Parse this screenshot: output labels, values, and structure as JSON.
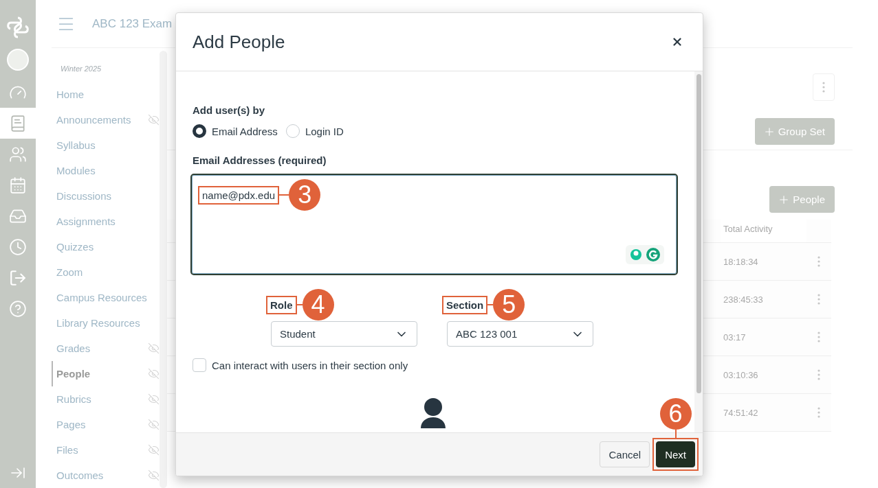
{
  "rail": {
    "items": [
      {
        "selected": false
      },
      {
        "selected": false
      },
      {
        "selected": true
      },
      {
        "selected": false
      },
      {
        "selected": false
      },
      {
        "selected": false
      },
      {
        "selected": false
      },
      {
        "selected": false
      },
      {
        "selected": false
      }
    ]
  },
  "course_nav": {
    "title": "ABC 123 Exam",
    "term": "Winter 2025",
    "items": [
      {
        "label": "Home",
        "hidden": false,
        "selected": false
      },
      {
        "label": "Announcements",
        "hidden": true,
        "selected": false
      },
      {
        "label": "Syllabus",
        "hidden": false,
        "selected": false
      },
      {
        "label": "Modules",
        "hidden": false,
        "selected": false
      },
      {
        "label": "Discussions",
        "hidden": false,
        "selected": false
      },
      {
        "label": "Assignments",
        "hidden": false,
        "selected": false
      },
      {
        "label": "Quizzes",
        "hidden": false,
        "selected": false
      },
      {
        "label": "Zoom",
        "hidden": false,
        "selected": false
      },
      {
        "label": "Campus Resources",
        "hidden": false,
        "selected": false
      },
      {
        "label": "Library Resources",
        "hidden": false,
        "selected": false
      },
      {
        "label": "Grades",
        "hidden": true,
        "selected": false
      },
      {
        "label": "People",
        "hidden": true,
        "selected": true
      },
      {
        "label": "Rubrics",
        "hidden": true,
        "selected": false
      },
      {
        "label": "Pages",
        "hidden": true,
        "selected": false
      },
      {
        "label": "Files",
        "hidden": true,
        "selected": false
      },
      {
        "label": "Outcomes",
        "hidden": true,
        "selected": false
      }
    ]
  },
  "page": {
    "buttons": [
      {
        "label": "Group Set"
      },
      {
        "label": "People"
      }
    ],
    "table": {
      "columns": [
        "Total Activity"
      ],
      "rows": [
        {
          "total_activity": "18:18:34"
        },
        {
          "total_activity": "238:45:33"
        },
        {
          "total_activity": "03:17"
        },
        {
          "total_activity": "03:10:36"
        },
        {
          "total_activity": "74:51:42"
        }
      ]
    }
  },
  "dialog": {
    "title": "Add People",
    "add_by": {
      "label": "Add user(s) by",
      "options": [
        {
          "label": "Email Address",
          "selected": true
        },
        {
          "label": "Login ID",
          "selected": false
        }
      ]
    },
    "emails": {
      "label": "Email Addresses (required)",
      "value": "name@pdx.edu",
      "callout": "3"
    },
    "role": {
      "label": "Role",
      "value": "Student",
      "callout": "4"
    },
    "section": {
      "label": "Section",
      "value": "ABC 123 001",
      "callout": "5"
    },
    "section_only": {
      "label": "Can interact with users in their section only",
      "checked": false
    },
    "buttons": [
      {
        "label": "Cancel",
        "kind": "secondary"
      },
      {
        "label": "Next",
        "kind": "primary",
        "callout": "6"
      }
    ]
  }
}
